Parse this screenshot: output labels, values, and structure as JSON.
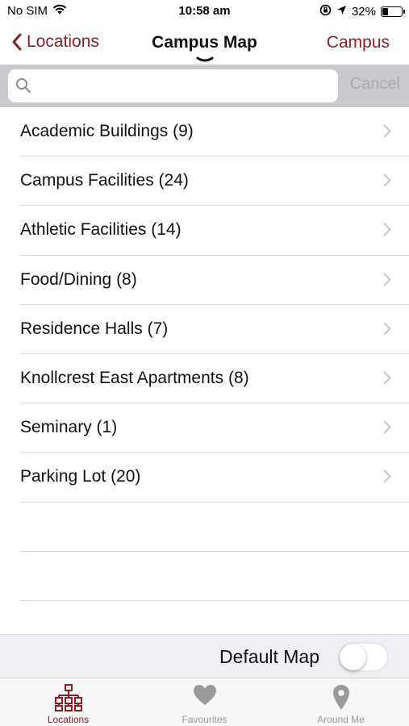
{
  "status_bar": {
    "carrier": "No SIM",
    "time": "10:58 am",
    "battery_percent_label": "32%",
    "battery_level": 0.32
  },
  "nav": {
    "back_label": "Locations",
    "title": "Campus Map",
    "right_label": "Campus"
  },
  "search": {
    "value": "",
    "placeholder": "",
    "cancel_label": "Cancel"
  },
  "categories": [
    {
      "label": "Academic Buildings (9)"
    },
    {
      "label": "Campus Facilities (24)"
    },
    {
      "label": "Athletic Facilities (14)"
    },
    {
      "label": "Food/Dining (8)"
    },
    {
      "label": "Residence Halls (7)"
    },
    {
      "label": "Knollcrest East Apartments (8)"
    },
    {
      "label": "Seminary (1)"
    },
    {
      "label": "Parking Lot (20)"
    }
  ],
  "default_map": {
    "label": "Default Map",
    "enabled": false
  },
  "tabs": [
    {
      "label": "Locations",
      "icon": "sitemap-icon",
      "active": true
    },
    {
      "label": "Favourites",
      "icon": "heart-icon",
      "active": false
    },
    {
      "label": "Around Me",
      "icon": "map-pin-icon",
      "active": false
    }
  ],
  "colors": {
    "accent": "#8b1f24",
    "inactive_tab": "#999999",
    "search_bar_bg": "#c9c9ce"
  }
}
